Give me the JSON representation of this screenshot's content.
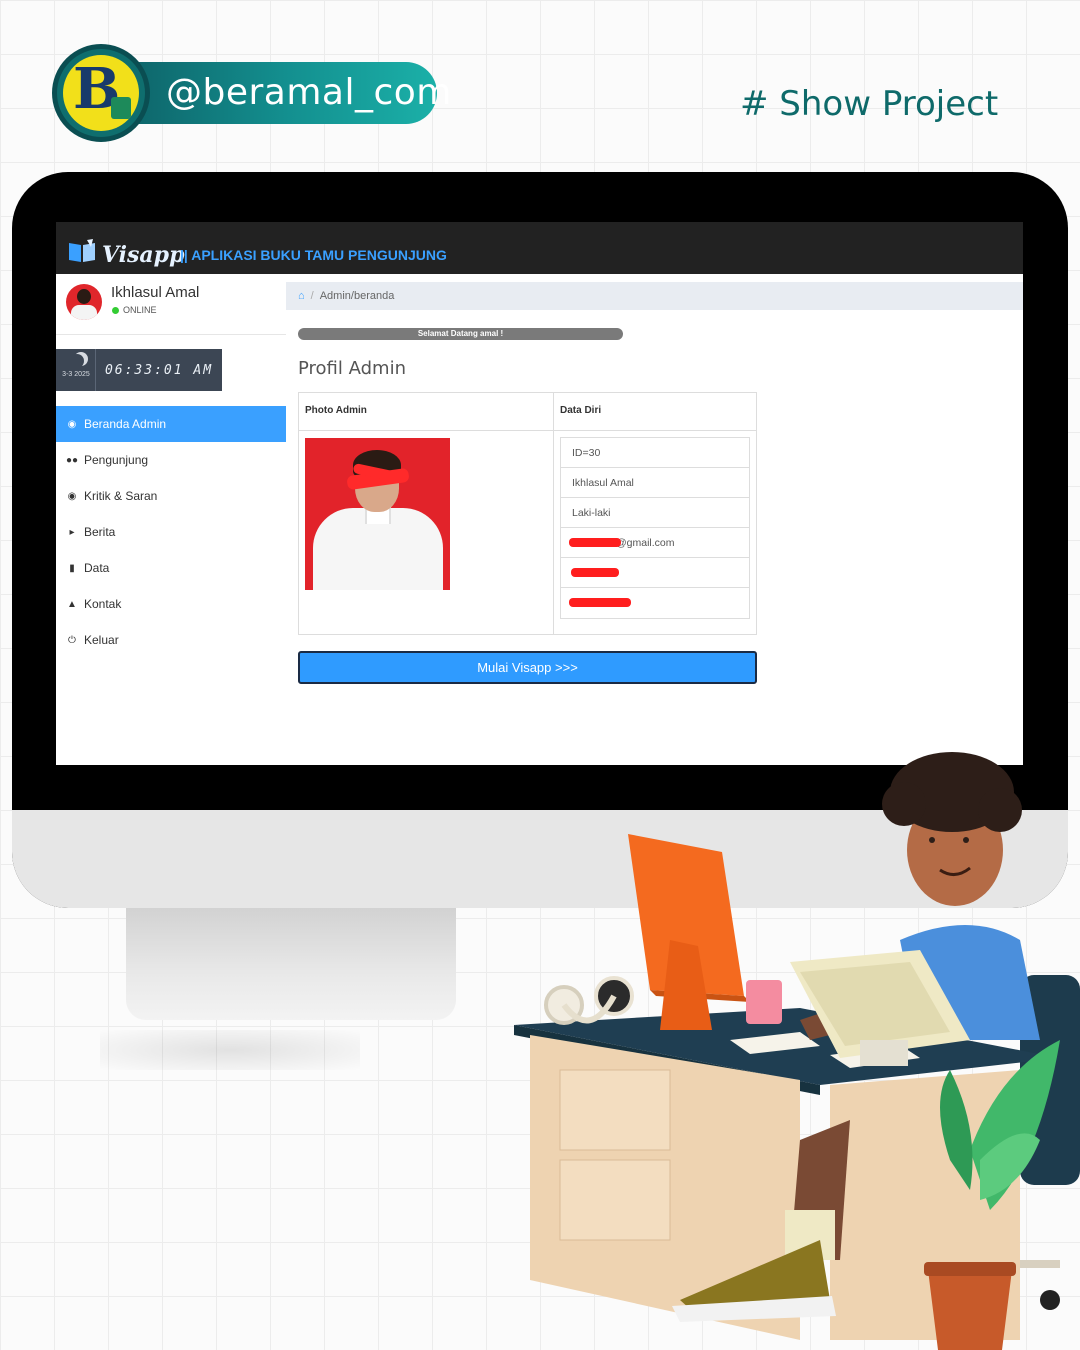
{
  "header": {
    "handle": "@beramal_com",
    "tag": "# Show Project"
  },
  "app": {
    "brand": "Visapp",
    "subtitle": "|| APLIKASI BUKU TAMU PENGUNJUNG",
    "user": {
      "name": "Ikhlasul Amal",
      "status": "ONLINE"
    },
    "clock": {
      "date": "3-3 2025",
      "time": "06:33:01 AM"
    },
    "menu": [
      {
        "label": "Beranda Admin",
        "icon": "dashboard-icon"
      },
      {
        "label": "Pengunjung",
        "icon": "users-icon"
      },
      {
        "label": "Kritik & Saran",
        "icon": "comments-icon"
      },
      {
        "label": "Berita",
        "icon": "bullhorn-icon"
      },
      {
        "label": "Data",
        "icon": "file-icon"
      },
      {
        "label": "Kontak",
        "icon": "user-icon"
      },
      {
        "label": "Keluar",
        "icon": "power-icon"
      }
    ],
    "breadcrumb": "Admin/beranda",
    "welcome": "Selamat Datang amal !",
    "page_title": "Profil Admin",
    "table": {
      "photo_header": "Photo Admin",
      "data_header": "Data Diri",
      "rows": [
        "ID=30",
        "Ikhlasul Amal",
        "Laki-laki",
        "@gmail.com",
        "",
        ""
      ]
    },
    "start_button": "Mulai Visapp >>>"
  },
  "colors": {
    "accent": "#3aa0ff",
    "navbar": "#222222",
    "brand_teal": "#0e6a6a"
  }
}
